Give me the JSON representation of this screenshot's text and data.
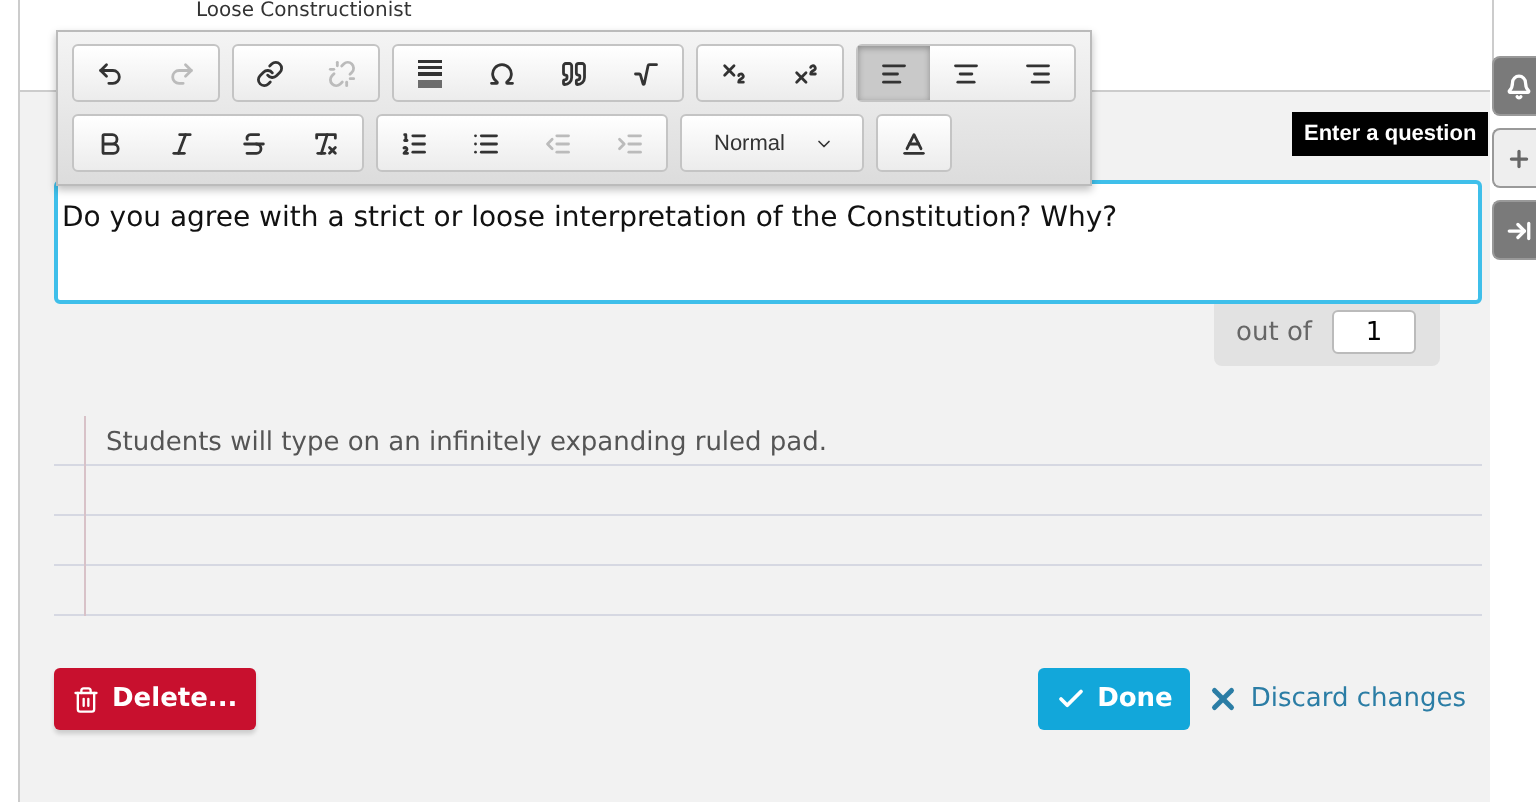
{
  "previous_answer": {
    "text": "Loose Constructionist"
  },
  "toolbar": {
    "rows": [
      [
        {
          "buttons": [
            {
              "kind": "undo",
              "disabled": false
            },
            {
              "kind": "redo",
              "disabled": true
            }
          ]
        },
        {
          "buttons": [
            {
              "kind": "link",
              "disabled": false
            },
            {
              "kind": "unlink",
              "disabled": true
            }
          ]
        },
        {
          "buttons": [
            {
              "kind": "rule",
              "disabled": false
            },
            {
              "kind": "omega",
              "disabled": false
            },
            {
              "kind": "quote",
              "disabled": false
            },
            {
              "kind": "sqrt",
              "disabled": false
            }
          ]
        },
        {
          "buttons": [
            {
              "kind": "subscript",
              "disabled": false
            },
            {
              "kind": "superscript",
              "disabled": false
            }
          ]
        },
        {
          "buttons": [
            {
              "kind": "align-left",
              "selected": true
            },
            {
              "kind": "align-center",
              "selected": false
            },
            {
              "kind": "align-right",
              "selected": false
            }
          ]
        }
      ],
      [
        {
          "buttons": [
            {
              "kind": "bold",
              "disabled": false
            },
            {
              "kind": "italic",
              "disabled": false
            },
            {
              "kind": "strike",
              "disabled": false
            },
            {
              "kind": "clear",
              "disabled": false
            }
          ]
        },
        {
          "buttons": [
            {
              "kind": "ordered-list",
              "disabled": false
            },
            {
              "kind": "bullet-list",
              "disabled": false
            },
            {
              "kind": "outdent",
              "disabled": true
            },
            {
              "kind": "indent",
              "disabled": true
            }
          ]
        },
        {
          "select": "Normal"
        },
        {
          "buttons": [
            {
              "kind": "text-color",
              "disabled": false
            }
          ]
        }
      ]
    ]
  },
  "tooltip": "Enter a question",
  "side_buttons": [
    {
      "kind": "bell"
    },
    {
      "kind": "plus"
    },
    {
      "kind": "move"
    }
  ],
  "question": {
    "value": "Do you agree with a strict or loose interpretation of the Constitution? Why?"
  },
  "points": {
    "label": "out of",
    "value": "1"
  },
  "answer_pad": {
    "placeholder": "Students will type on an infinitely expanding ruled pad."
  },
  "actions": {
    "delete": "Delete...",
    "done": "Done",
    "discard": "Discard changes"
  }
}
